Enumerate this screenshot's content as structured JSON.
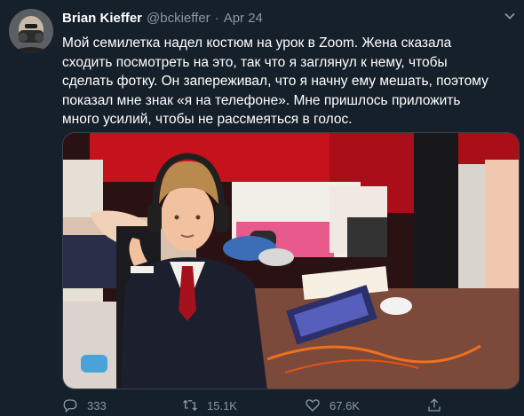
{
  "author": {
    "name": "Brian Kieffer",
    "handle": "@bckieffer",
    "separator": "·",
    "date": "Apr 24"
  },
  "tweet_text": "Мой семилетка надел костюм на урок в Zoom. Жена сказала\nсходить посмотреть на это, так что я заглянул к нему, чтобы\nсделать фотку. Он запереживал, что я начну ему мешать, поэтому\nпоказал мне знак «я на телефоне». Мне пришлось приложить\nмного усилий, чтобы не рассмеяться в голос.",
  "actions": {
    "reply_count": "333",
    "retweet_count": "15.1K",
    "like_count": "67.6K"
  },
  "icons": {
    "reply": "reply-icon",
    "retweet": "retweet-icon",
    "like": "heart-icon",
    "share": "share-icon",
    "more": "chevron-down-icon"
  },
  "colors": {
    "background": "#15202b",
    "secondary_text": "#8899a6",
    "border": "#38444d"
  }
}
